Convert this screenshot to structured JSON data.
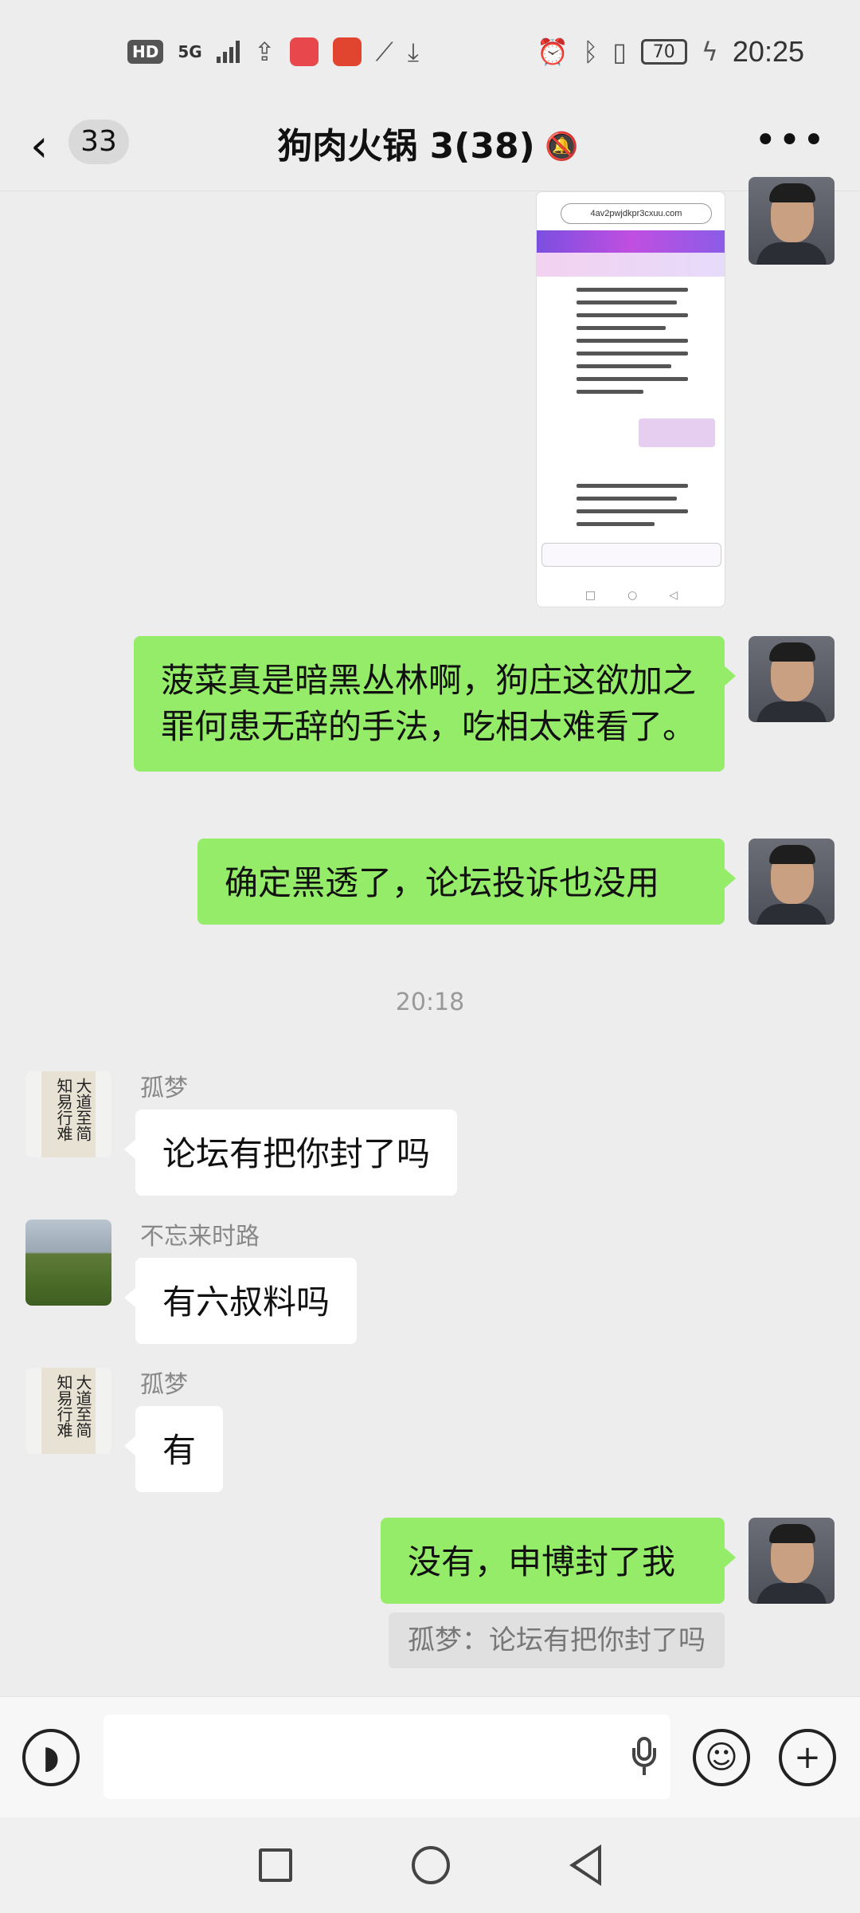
{
  "status_bar": {
    "left_badge": "HD",
    "network": "5G",
    "battery": "70",
    "time": "20:25"
  },
  "header": {
    "unread_count": "33",
    "title": "狗肉火锅 3(38)",
    "icons": [
      "back-icon",
      "mute-bell-icon",
      "more-icon"
    ]
  },
  "shared_screenshot": {
    "url_text": "4av2pwjdkpr3cxuu.com"
  },
  "messages": [
    {
      "side": "out",
      "text": "菠菜真是暗黑丛林啊，狗庄这欲加之罪何患无辞的手法，吃相太难看了。"
    },
    {
      "side": "out",
      "text": "确定黑透了，论坛投诉也没用"
    }
  ],
  "timestamp": "20:18",
  "messages2": [
    {
      "side": "in",
      "sender": "孤梦",
      "text": "论坛有把你封了吗"
    },
    {
      "side": "in",
      "sender": "不忘来时路",
      "text": "有六叔料吗"
    },
    {
      "side": "in",
      "sender": "孤梦",
      "text": "有"
    },
    {
      "side": "out",
      "text": "没有，申博封了我",
      "quote": "孤梦：论坛有把你封了吗"
    }
  ],
  "avatar_calligraphy_text": "大道至简知易行难",
  "input_bar": {
    "icons": [
      "voice-icon",
      "mic-icon",
      "emoji-icon",
      "plus-icon"
    ]
  },
  "colors": {
    "background": "#ededed",
    "outgoing_bubble": "#95ec69",
    "incoming_bubble": "#ffffff"
  }
}
